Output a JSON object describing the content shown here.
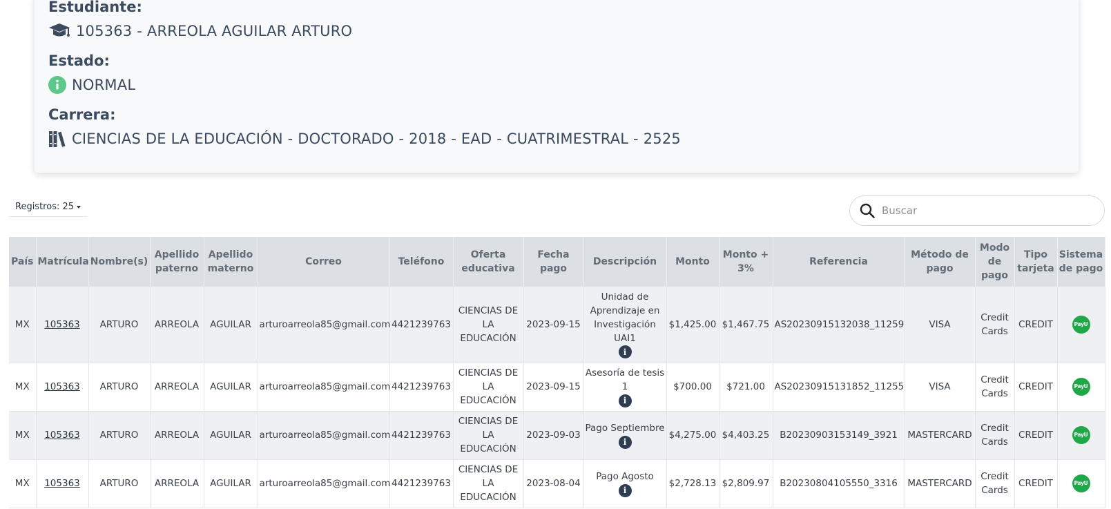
{
  "student": {
    "label": "Estudiante:",
    "value": "105363 - ARREOLA AGUILAR ARTURO",
    "icon": "graduation-cap-icon"
  },
  "status": {
    "label": "Estado:",
    "value": "NORMAL",
    "icon": "info-circle-icon",
    "color": "#5cc98a"
  },
  "career": {
    "label": "Carrera:",
    "value": "CIENCIAS DE LA EDUCACIÓN - DOCTORADO - 2018 - EAD - CUATRIMESTRAL - 2525",
    "icon": "books-icon"
  },
  "controls": {
    "registros_label": "Registros: 25",
    "search_placeholder": "Buscar"
  },
  "table": {
    "headers": [
      "País",
      "Matrícula",
      "Nombre(s)",
      "Apellido paterno",
      "Apellido materno",
      "Correo",
      "Teléfono",
      "Oferta educativa",
      "Fecha pago",
      "Descripción",
      "Monto",
      "Monto + 3%",
      "Referencia",
      "Método de pago",
      "Modo de pago",
      "Tipo tarjeta",
      "Sistema de pago"
    ],
    "rows": [
      {
        "pais": "MX",
        "matricula": "105363",
        "nombre": "ARTURO",
        "paterno": "ARREOLA",
        "materno": "AGUILAR",
        "correo": "arturoarreola85@gmail.com",
        "telefono": "4421239763",
        "oferta": "CIENCIAS DE LA EDUCACIÓN",
        "fecha": "2023-09-15",
        "descripcion": "Unidad de Aprendizaje en Investigación UAI1",
        "monto": "$1,425.00",
        "monto3": "$1,467.75",
        "referencia": "AS20230915132038_11259",
        "metodo": "VISA",
        "modo": "Credit Cards",
        "tipo": "CREDIT",
        "sistema": "PayU"
      },
      {
        "pais": "MX",
        "matricula": "105363",
        "nombre": "ARTURO",
        "paterno": "ARREOLA",
        "materno": "AGUILAR",
        "correo": "arturoarreola85@gmail.com",
        "telefono": "4421239763",
        "oferta": "CIENCIAS DE LA EDUCACIÓN",
        "fecha": "2023-09-15",
        "descripcion": "Asesoría de tesis 1",
        "monto": "$700.00",
        "monto3": "$721.00",
        "referencia": "AS20230915131852_11255",
        "metodo": "VISA",
        "modo": "Credit Cards",
        "tipo": "CREDIT",
        "sistema": "PayU"
      },
      {
        "pais": "MX",
        "matricula": "105363",
        "nombre": "ARTURO",
        "paterno": "ARREOLA",
        "materno": "AGUILAR",
        "correo": "arturoarreola85@gmail.com",
        "telefono": "4421239763",
        "oferta": "CIENCIAS DE LA EDUCACIÓN",
        "fecha": "2023-09-03",
        "descripcion": "Pago Septiembre",
        "monto": "$4,275.00",
        "monto3": "$4,403.25",
        "referencia": "B20230903153149_3921",
        "metodo": "MASTERCARD",
        "modo": "Credit Cards",
        "tipo": "CREDIT",
        "sistema": "PayU"
      },
      {
        "pais": "MX",
        "matricula": "105363",
        "nombre": "ARTURO",
        "paterno": "ARREOLA",
        "materno": "AGUILAR",
        "correo": "arturoarreola85@gmail.com",
        "telefono": "4421239763",
        "oferta": "CIENCIAS DE LA EDUCACIÓN",
        "fecha": "2023-08-04",
        "descripcion": "Pago Agosto",
        "monto": "$2,728.13",
        "monto3": "$2,809.97",
        "referencia": "B20230804105550_3316",
        "metodo": "MASTERCARD",
        "modo": "Credit Cards",
        "tipo": "CREDIT",
        "sistema": "PayU"
      }
    ]
  },
  "colors": {
    "header_bg": "#dcdfe3",
    "payu_green": "#1fa848",
    "info_dark": "#2f3d52"
  }
}
